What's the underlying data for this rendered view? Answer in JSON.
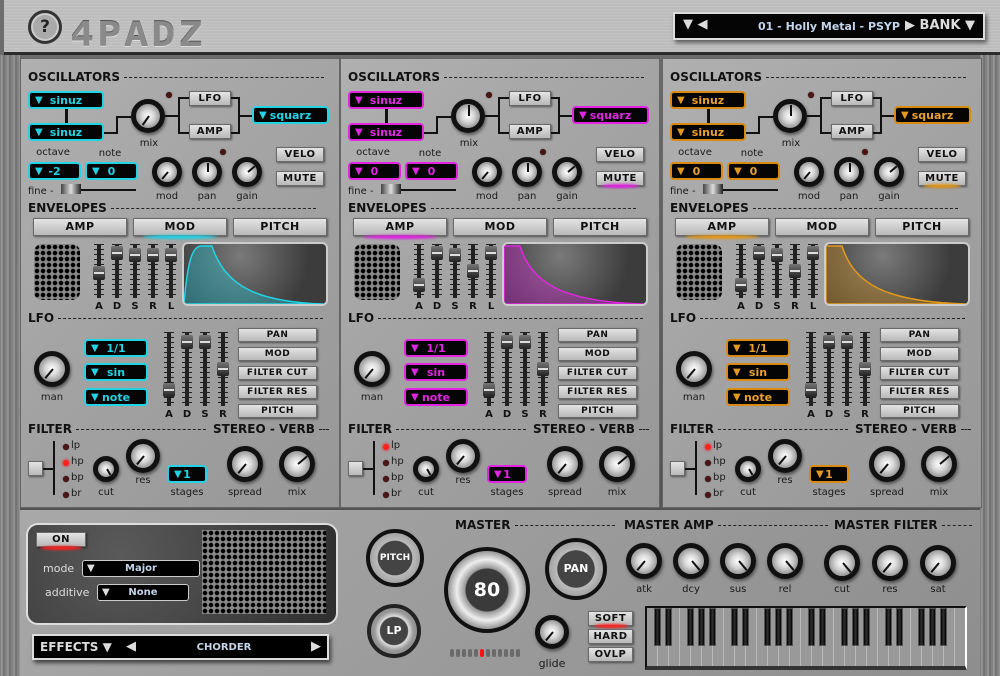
{
  "app": {
    "logo": "4PADZ",
    "help_label": "?"
  },
  "preset": {
    "left_arrows": "▼ ◀",
    "name": "01 - Holly Metal - PSYP",
    "right_label": "▶ BANK ▼"
  },
  "colors": {
    "pad1": "#22d3e6",
    "pad2": "#e225e2",
    "pad3": "#d98a12"
  },
  "pads": [
    {
      "theme": "cyan",
      "osc_title": "OSCILLATORS",
      "osc1": "sinuz",
      "osc2": "sinuz",
      "out_wave": "squarz",
      "mix_label": "mix",
      "lfo_btn": "LFO",
      "amp_btn": "AMP",
      "octave_label": "octave",
      "octave": "-2",
      "note_label": "note",
      "note": "0",
      "fine_label": "fine -",
      "mod_label": "mod",
      "pan_label": "pan",
      "gain_label": "gain",
      "velo_btn": "VELO",
      "mute_btn": "MUTE",
      "env_title": "ENVELOPES",
      "env_tabs": [
        "AMP",
        "MOD",
        "PITCH"
      ],
      "env_active": 1,
      "env_sliders": [
        "A",
        "D",
        "S",
        "R",
        "L"
      ],
      "lfo_title": "LFO",
      "lfo_rate": "1/1",
      "lfo_wave": "sin",
      "lfo_sync": "note",
      "man_label": "man",
      "lfo_sliders": [
        "A",
        "D",
        "S",
        "R"
      ],
      "lfo_targets": [
        "PAN",
        "MOD",
        "FILTER CUT",
        "FILTER RES",
        "PITCH"
      ],
      "filter_title": "FILTER",
      "filter_types": [
        "lp",
        "hp",
        "bp",
        "br"
      ],
      "filter_active": "hp",
      "cut_label": "cut",
      "res_label": "res",
      "stages_label": "stages",
      "stages": "1",
      "verb_title": "STEREO - VERB",
      "spread_label": "spread",
      "mix2_label": "mix"
    },
    {
      "theme": "mag",
      "osc_title": "OSCILLATORS",
      "osc1": "sinuz",
      "osc2": "sinuz",
      "out_wave": "squarz",
      "mix_label": "mix",
      "lfo_btn": "LFO",
      "amp_btn": "AMP",
      "octave_label": "octave",
      "octave": "0",
      "note_label": "note",
      "note": "0",
      "fine_label": "fine -",
      "mod_label": "mod",
      "pan_label": "pan",
      "gain_label": "gain",
      "velo_btn": "VELO",
      "mute_btn": "MUTE",
      "env_title": "ENVELOPES",
      "env_tabs": [
        "AMP",
        "MOD",
        "PITCH"
      ],
      "env_active": 0,
      "env_sliders": [
        "A",
        "D",
        "S",
        "R",
        "L"
      ],
      "lfo_title": "LFO",
      "lfo_rate": "1/1",
      "lfo_wave": "sin",
      "lfo_sync": "note",
      "man_label": "man",
      "lfo_sliders": [
        "A",
        "D",
        "S",
        "R"
      ],
      "lfo_targets": [
        "PAN",
        "MOD",
        "FILTER CUT",
        "FILTER RES",
        "PITCH"
      ],
      "filter_title": "FILTER",
      "filter_types": [
        "lp",
        "hp",
        "bp",
        "br"
      ],
      "filter_active": "lp",
      "cut_label": "cut",
      "res_label": "res",
      "stages_label": "stages",
      "stages": "1",
      "verb_title": "STEREO - VERB",
      "spread_label": "spread",
      "mix2_label": "mix"
    },
    {
      "theme": "org",
      "osc_title": "OSCILLATORS",
      "osc1": "sinuz",
      "osc2": "sinuz",
      "out_wave": "squarz",
      "mix_label": "mix",
      "lfo_btn": "LFO",
      "amp_btn": "AMP",
      "octave_label": "octave",
      "octave": "0",
      "note_label": "note",
      "note": "0",
      "fine_label": "fine -",
      "mod_label": "mod",
      "pan_label": "pan",
      "gain_label": "gain",
      "velo_btn": "VELO",
      "mute_btn": "MUTE",
      "env_title": "ENVELOPES",
      "env_tabs": [
        "AMP",
        "MOD",
        "PITCH"
      ],
      "env_active": 0,
      "env_sliders": [
        "A",
        "D",
        "S",
        "R",
        "L"
      ],
      "lfo_title": "LFO",
      "lfo_rate": "1/1",
      "lfo_wave": "sin",
      "lfo_sync": "note",
      "man_label": "man",
      "lfo_sliders": [
        "A",
        "D",
        "S",
        "R"
      ],
      "lfo_targets": [
        "PAN",
        "MOD",
        "FILTER CUT",
        "FILTER RES",
        "PITCH"
      ],
      "filter_title": "FILTER",
      "filter_types": [
        "lp",
        "hp",
        "bp",
        "br"
      ],
      "filter_active": "lp",
      "cut_label": "cut",
      "res_label": "res",
      "stages_label": "stages",
      "stages": "1",
      "verb_title": "STEREO - VERB",
      "spread_label": "spread",
      "mix2_label": "mix"
    }
  ],
  "effects": {
    "on_label": "ON",
    "mode_label": "mode",
    "mode": "Major",
    "additive_label": "additive",
    "additive": "None",
    "effects_label": "EFFECTS ▼",
    "left_arrow": "◀",
    "effect_name": "CHORDER",
    "right_arrow": "▶"
  },
  "master": {
    "title": "MASTER",
    "pitch_label": "PITCH",
    "lp_label": "LP",
    "volume": "80",
    "pan_label": "PAN",
    "glide_label": "glide",
    "modes": [
      "SOFT",
      "HARD",
      "OVLP"
    ],
    "active_mode": "SOFT",
    "meter_segments": 12,
    "meter_active_index": 5
  },
  "master_amp": {
    "title": "MASTER AMP",
    "knobs": [
      "atk",
      "dcy",
      "sus",
      "rel"
    ]
  },
  "master_filter": {
    "title": "MASTER FILTER",
    "knobs": [
      "cut",
      "res",
      "sat"
    ]
  }
}
